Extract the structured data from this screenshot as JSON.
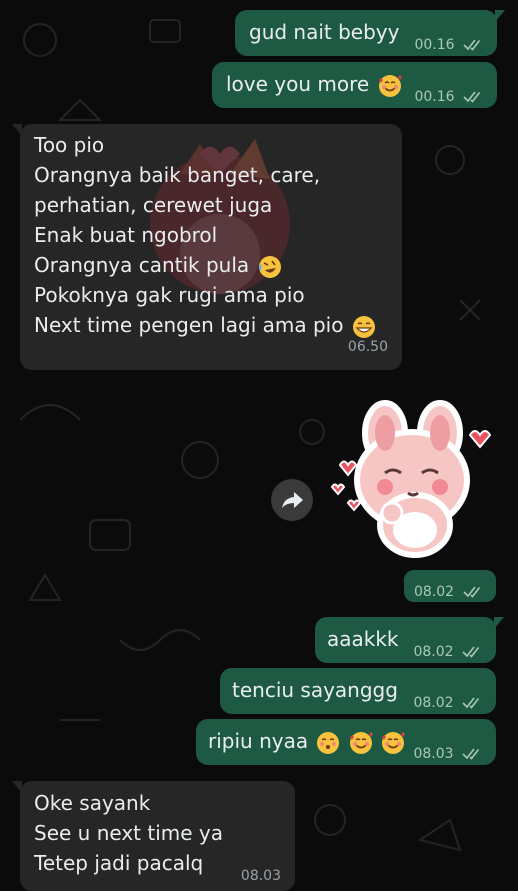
{
  "colors": {
    "outgoing_bubble": "#1e5a43",
    "incoming_bubble": "#262626",
    "background": "#0b0b0b",
    "read_ticks": "#a8c7b7"
  },
  "messages": [
    {
      "id": "m1",
      "direction": "outgoing",
      "text": "gud nait bebyy",
      "time": "00.16",
      "ticks": "read"
    },
    {
      "id": "m2",
      "direction": "outgoing",
      "text": "love you more",
      "emojis": [
        "smiling-face-with-hearts"
      ],
      "time": "00.16",
      "ticks": "read"
    },
    {
      "id": "m3",
      "direction": "incoming",
      "lines": [
        "Too pio",
        "Orangnya baik banget, care,",
        "perhatian, cerewet juga",
        "Enak buat ngobrol",
        "Orangnya cantik pula",
        "Pokoknya gak rugi ama pio",
        "Next time pengen lagi ama pio"
      ],
      "time": "06.50"
    },
    {
      "id": "m4",
      "direction": "outgoing",
      "type": "sticker",
      "sticker": "pink-bunny-blowing-kiss-sticker",
      "time": "08.02",
      "ticks": "read"
    },
    {
      "id": "m5",
      "direction": "outgoing",
      "text": "aaakkk",
      "time": "08.02",
      "ticks": "read"
    },
    {
      "id": "m6",
      "direction": "outgoing",
      "text": "tenciu sayanggg",
      "time": "08.02",
      "ticks": "read"
    },
    {
      "id": "m7",
      "direction": "outgoing",
      "text": "ripiu nyaa",
      "emojis": [
        "face-blowing-kiss",
        "smiling-face-with-hearts",
        "smiling-face-with-hearts"
      ],
      "time": "08.03",
      "ticks": "read"
    },
    {
      "id": "m8",
      "direction": "incoming",
      "lines": [
        "Oke sayank",
        "See u next time ya",
        "Tetep jadi pacalq"
      ],
      "time": "08.03"
    }
  ],
  "forward_button": {
    "icon": "forward-arrow-icon"
  }
}
